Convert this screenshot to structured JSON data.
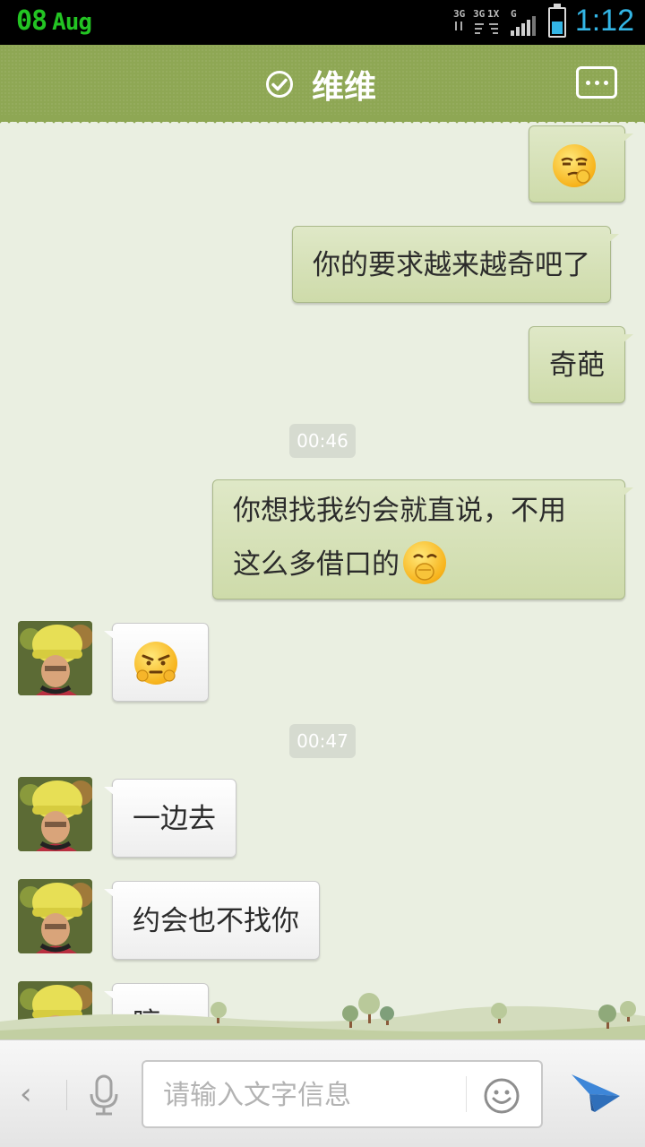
{
  "status_bar": {
    "day": "08",
    "month": "Aug",
    "network_labels": [
      "3G",
      "3G",
      "1X",
      "G"
    ],
    "battery_icon": "battery-icon",
    "time": "1:12"
  },
  "header": {
    "verified_icon": "check-circle-icon",
    "contact_name": "维维",
    "more_icon": "more-menu-icon"
  },
  "messages": [
    {
      "id": "m1",
      "side": "out",
      "type": "emoji",
      "emoji": "smug-face"
    },
    {
      "id": "m2",
      "side": "out",
      "type": "text",
      "text": "你的要求越来越奇吧了"
    },
    {
      "id": "m3",
      "side": "out",
      "type": "text",
      "text": "奇葩"
    },
    {
      "id": "t1",
      "type": "time",
      "text": "00:46"
    },
    {
      "id": "m4",
      "side": "out",
      "type": "text",
      "lines": [
        "你想找我约会就直说，不用",
        "这么多借口的"
      ],
      "emoji": "laugh-covering-mouth"
    },
    {
      "id": "m5",
      "side": "in",
      "type": "emoji",
      "emoji": "annoyed-face"
    },
    {
      "id": "t2",
      "type": "time",
      "text": "00:47"
    },
    {
      "id": "m6",
      "side": "in",
      "type": "text",
      "text": "一边去"
    },
    {
      "id": "m7",
      "side": "in",
      "type": "text",
      "text": "约会也不找你"
    },
    {
      "id": "m8",
      "side": "in",
      "type": "text",
      "text": "哼"
    }
  ],
  "input_bar": {
    "collapse_label": "‹",
    "placeholder": "请输入文字信息",
    "value": "",
    "mic_icon": "microphone-icon",
    "emoji_icon": "smiley-icon",
    "send_icon": "paper-plane-icon"
  },
  "colors": {
    "header_green": "#8ea754",
    "chat_bg": "#eaefe1",
    "outgoing_bubble": "#d6e1b8",
    "incoming_bubble": "#ffffff",
    "date_green": "#23c423",
    "time_blue": "#33b5e5",
    "send_blue": "#3d86d8"
  }
}
